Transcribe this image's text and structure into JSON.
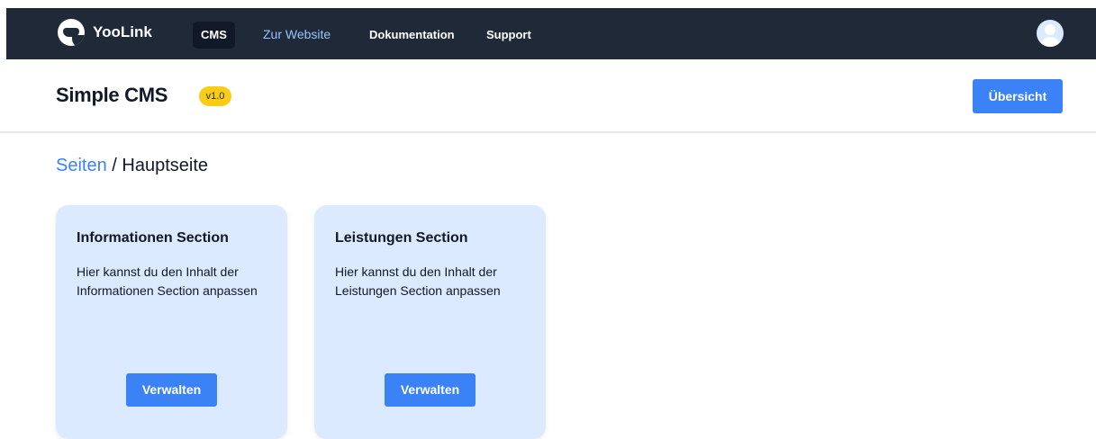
{
  "navbar": {
    "brand": "YooLink",
    "items": [
      {
        "label": "CMS"
      },
      {
        "label": "Zur Website"
      },
      {
        "label": "Dokumentation"
      },
      {
        "label": "Support"
      }
    ],
    "avatar_icon": "user-avatar-icon"
  },
  "header": {
    "title": "Simple CMS",
    "version": "v1.0",
    "overview_button": "Übersicht"
  },
  "breadcrumb": {
    "parent": "Seiten",
    "separator": " / ",
    "current": "Hauptseite"
  },
  "cards": [
    {
      "title": "Informationen Section",
      "text": "Hier kannst du den Inhalt der Informationen Section anpassen",
      "button": "Verwalten"
    },
    {
      "title": "Leistungen Section",
      "text": "Hier kannst du den Inhalt der Leistungen Section anpassen",
      "button": "Verwalten"
    }
  ],
  "colors": {
    "navbar_bg": "#1f2937",
    "accent": "#3b82f6",
    "card_bg": "#dbeafe",
    "badge": "#facc15"
  }
}
